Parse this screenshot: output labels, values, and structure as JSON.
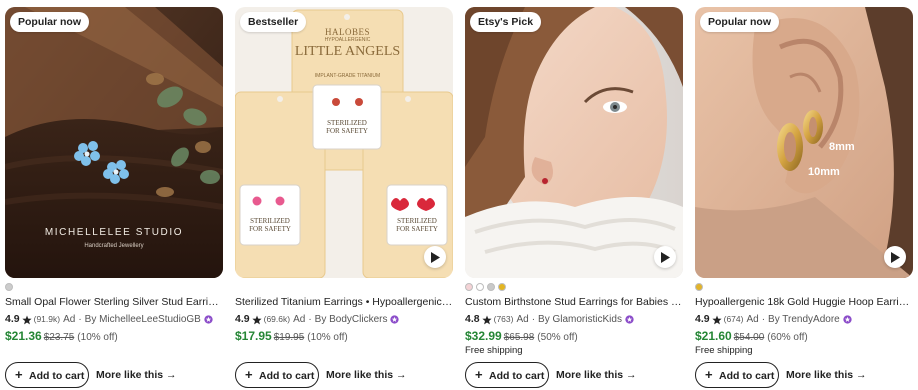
{
  "cards": [
    {
      "badge": "Popular now",
      "image_text": {
        "studio": "MICHELLELEE STUDIO",
        "tagline": "Handcrafted Jewellery"
      },
      "swatches": [
        "#cccccc"
      ],
      "has_video": false,
      "title": "Small Opal Flower Sterling Silver Stud Earrings wi...",
      "rating": "4.9",
      "review_count": "(91.9k)",
      "ad": "Ad",
      "seller": "By MichelleeLeeStudioGB",
      "price": "$21.36",
      "original_price": "$23.75",
      "discount": "(10% off)",
      "shipping": "",
      "cart_label": "Add to cart",
      "more_label": "More like this"
    },
    {
      "badge": "Bestseller",
      "image_text": {
        "brand": "HALOBES",
        "brand_sub": "HYPOALLERGENIC",
        "product_line": "LITTLE ANGELS",
        "product_sub": "IMPLANT-GRADE TITANIUM",
        "card_label": "STERILIZED FOR SAFETY"
      },
      "swatches": [],
      "has_video": true,
      "title": "Sterilized Titanium Earrings • Hypoallergenic Titan...",
      "rating": "4.9",
      "review_count": "(69.6k)",
      "ad": "Ad",
      "seller": "By BodyClickers",
      "price": "$17.95",
      "original_price": "$19.95",
      "discount": "(10% off)",
      "shipping": "",
      "cart_label": "Add to cart",
      "more_label": "More like this"
    },
    {
      "badge": "Etsy's Pick",
      "image_text": {},
      "swatches": [
        "#f4d3d6",
        "#ffffff",
        "#c9c9c9",
        "#e3b521"
      ],
      "has_video": true,
      "title": "Custom Birthstone Stud Earrings for Babies or Kid...",
      "rating": "4.8",
      "review_count": "(763)",
      "ad": "Ad",
      "seller": "By GlamoristicKids",
      "price": "$32.99",
      "original_price": "$65.98",
      "discount": "(50% off)",
      "shipping": "Free shipping",
      "cart_label": "Add to cart",
      "more_label": "More like this"
    },
    {
      "badge": "Popular now",
      "image_text": {
        "size_a": "8mm",
        "size_b": "10mm"
      },
      "swatches": [
        "#e2b32a"
      ],
      "has_video": true,
      "title": "Hypoallergenic 18k Gold Huggie Hoop Earrings for...",
      "rating": "4.9",
      "review_count": "(674)",
      "ad": "Ad",
      "seller": "By TrendyAdore",
      "price": "$21.60",
      "original_price": "$54.00",
      "discount": "(60% off)",
      "shipping": "Free shipping",
      "cart_label": "Add to cart",
      "more_label": "More like this"
    }
  ],
  "icons": {
    "star": "star-icon",
    "seller_badge": "star-seller-icon",
    "play": "play-icon",
    "plus": "plus-icon",
    "arrow": "arrow-right-icon"
  },
  "colors": {
    "price": "#258635",
    "star": "#222222",
    "seller_badge": "#8b4cc9",
    "badge_bg": "#ffffff"
  }
}
